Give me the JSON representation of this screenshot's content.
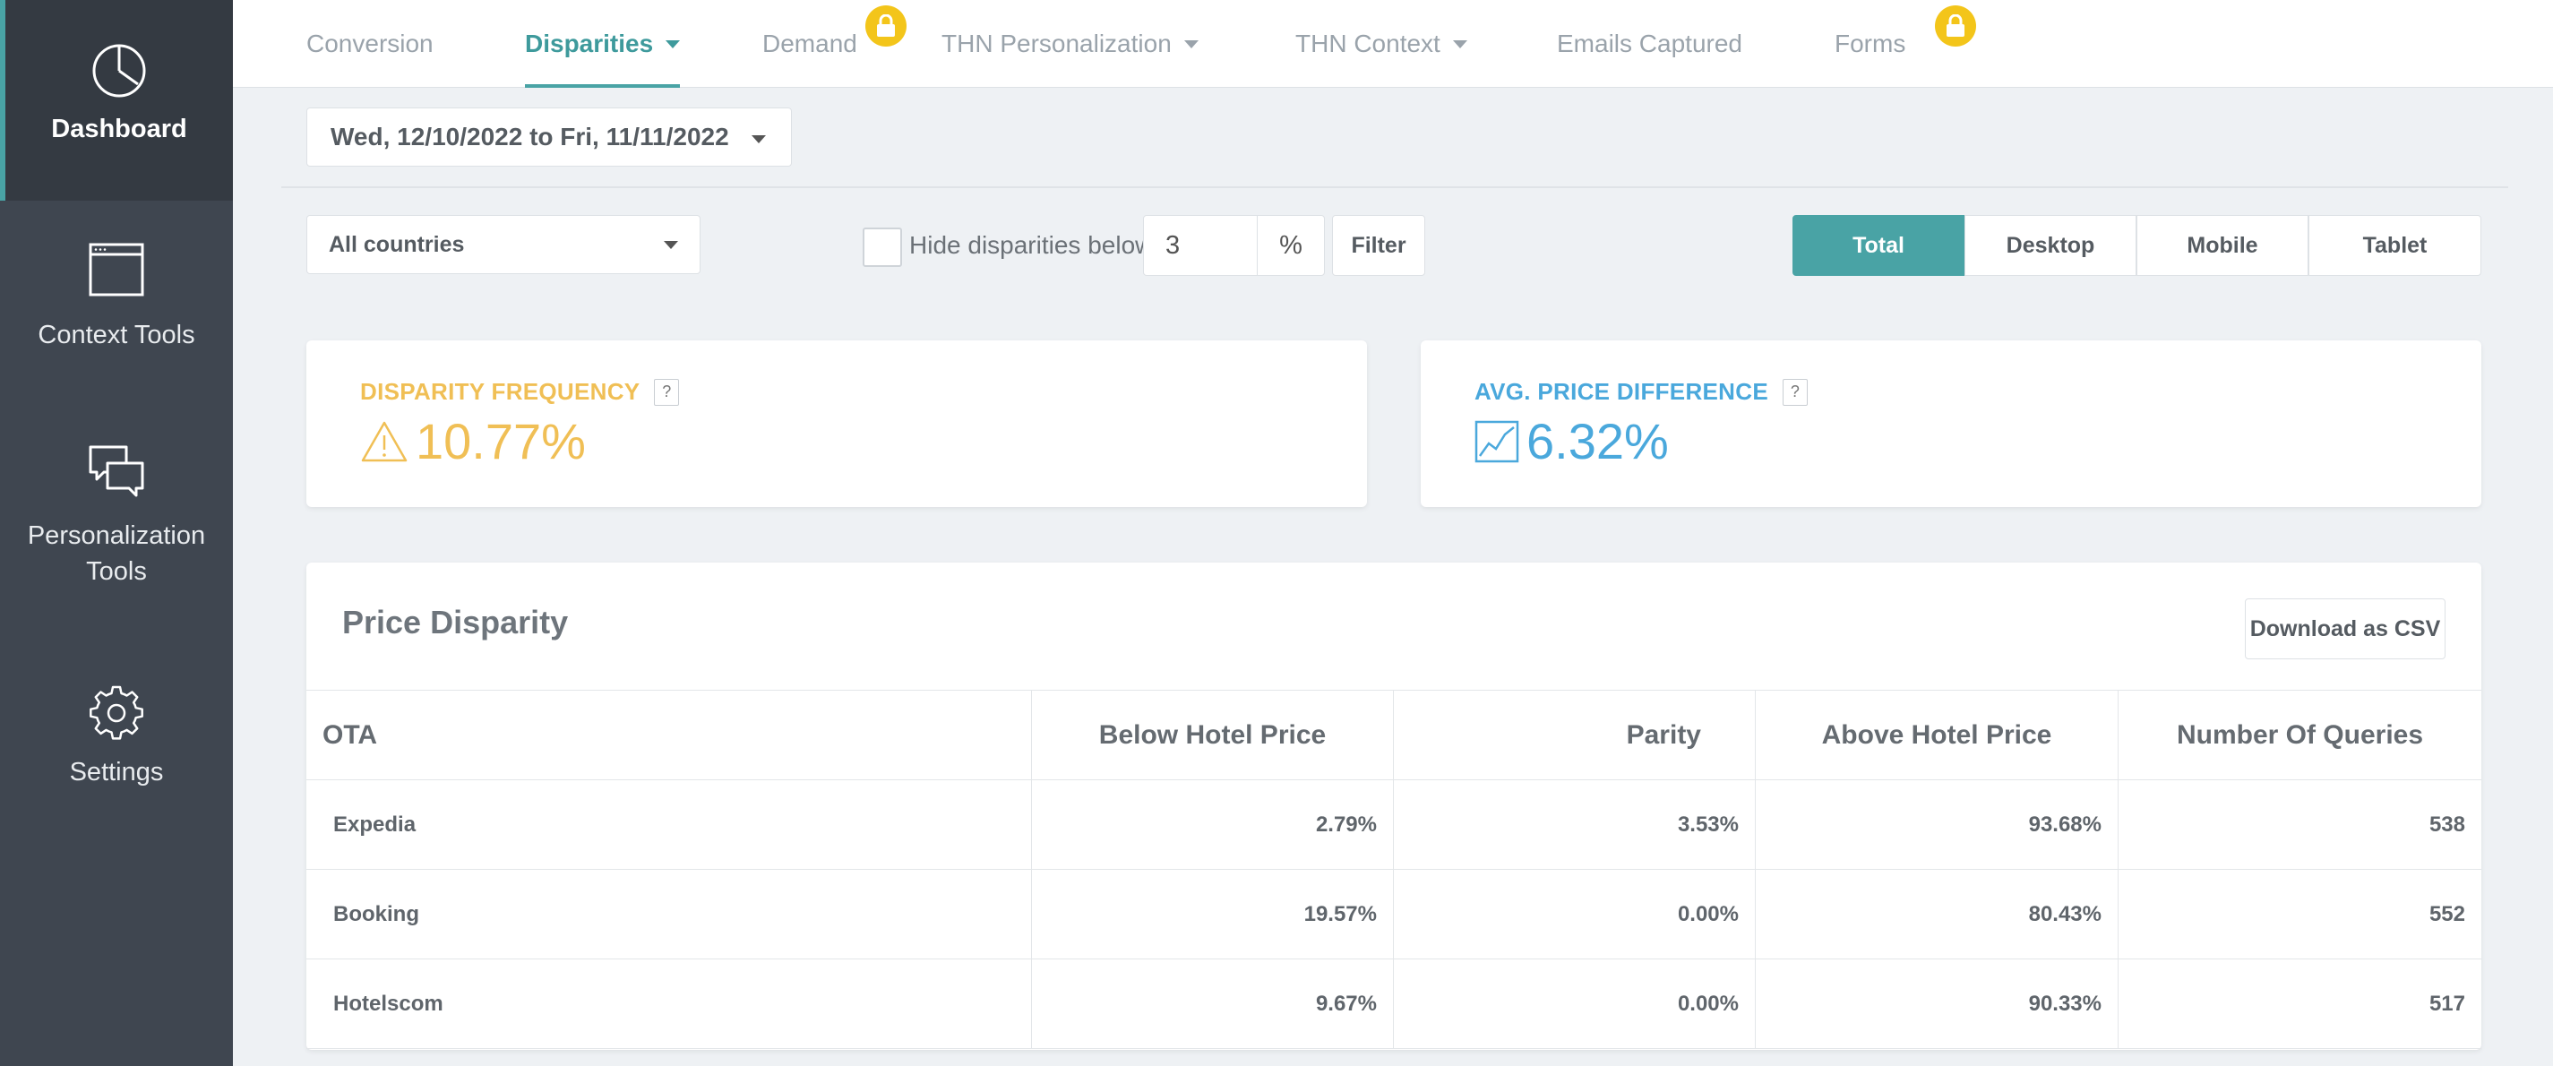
{
  "sidebar": {
    "items": [
      {
        "label": "Dashboard",
        "icon": "pie-chart-icon"
      },
      {
        "label": "Context Tools",
        "icon": "window-icon"
      },
      {
        "label": "Personalization Tools",
        "icon": "chat-bubbles-icon"
      },
      {
        "label": "Settings",
        "icon": "gear-icon"
      }
    ]
  },
  "topnav": {
    "tabs": [
      {
        "label": "Conversion"
      },
      {
        "label": "Disparities"
      },
      {
        "label": "Demand"
      },
      {
        "label": "THN Personalization"
      },
      {
        "label": "THN Context"
      },
      {
        "label": "Emails Captured"
      },
      {
        "label": "Forms"
      }
    ]
  },
  "filters": {
    "date_range": "Wed, 12/10/2022 to Fri, 11/11/2022",
    "country": "All countries",
    "hide_label": "Hide disparities below",
    "threshold": "3",
    "percent": "%",
    "filter_button": "Filter",
    "devices": [
      "Total",
      "Desktop",
      "Mobile",
      "Tablet"
    ]
  },
  "kpis": {
    "frequency": {
      "title": "DISPARITY FREQUENCY",
      "help": "?",
      "value": "10.77%"
    },
    "price_diff": {
      "title": "AVG. PRICE DIFFERENCE",
      "help": "?",
      "value": "6.32%"
    }
  },
  "table": {
    "title": "Price Disparity",
    "download_label": "Download as CSV",
    "headers": [
      "OTA",
      "Below Hotel Price",
      "Parity",
      "Above Hotel Price",
      "Number Of Queries"
    ],
    "rows": [
      [
        "Expedia",
        "2.79%",
        "3.53%",
        "93.68%",
        "538"
      ],
      [
        "Booking",
        "19.57%",
        "0.00%",
        "80.43%",
        "552"
      ],
      [
        "Hotelscom",
        "9.67%",
        "0.00%",
        "90.33%",
        "517"
      ]
    ]
  },
  "colors": {
    "accent": "#49a3a5",
    "sidebar": "#3f4650",
    "warning": "#f0c060",
    "info": "#4aa8dc",
    "lock": "#f3c51a"
  }
}
